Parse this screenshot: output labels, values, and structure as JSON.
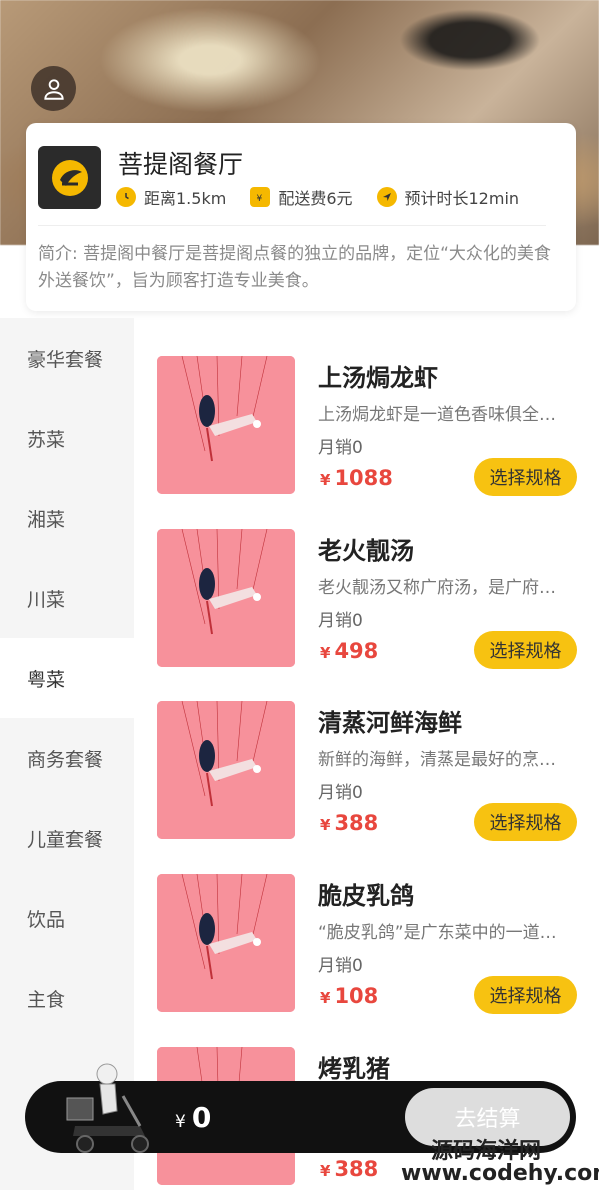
{
  "shop": {
    "name": "菩提阁餐厅",
    "distance": "距离1.5km",
    "delivery_fee": "配送费6元",
    "eta": "预计时长12min",
    "intro": "简介: 菩提阁中餐厅是菩提阁点餐的独立的品牌，定位“大众化的美食外送餐饮”，旨为顾客打造专业美食。"
  },
  "categories": [
    {
      "label": "豪华套餐",
      "active": false
    },
    {
      "label": "苏菜",
      "active": false
    },
    {
      "label": "湘菜",
      "active": false
    },
    {
      "label": "川菜",
      "active": false
    },
    {
      "label": "粤菜",
      "active": true
    },
    {
      "label": "商务套餐",
      "active": false
    },
    {
      "label": "儿童套餐",
      "active": false
    },
    {
      "label": "饮品",
      "active": false
    },
    {
      "label": "主食",
      "active": false
    }
  ],
  "currency_symbol": "¥",
  "products": [
    {
      "name": "上汤焗龙虾",
      "desc": "上汤焗龙虾是一道色香味俱全的传统名菜",
      "sales": "月销0",
      "price": "1088",
      "button": "选择规格"
    },
    {
      "name": "老火靓汤",
      "desc": "老火靓汤又称广府汤，是广府人传承数千年的食补养生秘方",
      "sales": "月销0",
      "price": "498",
      "button": "选择规格"
    },
    {
      "name": "清蒸河鲜海鲜",
      "desc": "新鲜的海鲜，清蒸是最好的烹饪方式",
      "sales": "月销0",
      "price": "388",
      "button": "选择规格"
    },
    {
      "name": "脆皮乳鸽",
      "desc": "“脆皮乳鸽”是广东菜中的一道传统名菜",
      "sales": "月销0",
      "price": "108",
      "button": "选择规格"
    },
    {
      "name": "烤乳猪",
      "desc": "",
      "sales": "",
      "price": "388",
      "button": ""
    }
  ],
  "cart": {
    "total": "0",
    "checkout_label": "去结算"
  },
  "watermark": {
    "title": "源码海洋网",
    "url": "www.codehy.com"
  },
  "colors": {
    "accent": "#f7c211",
    "price": "#e8473e",
    "product_bg": "#f7919b"
  }
}
